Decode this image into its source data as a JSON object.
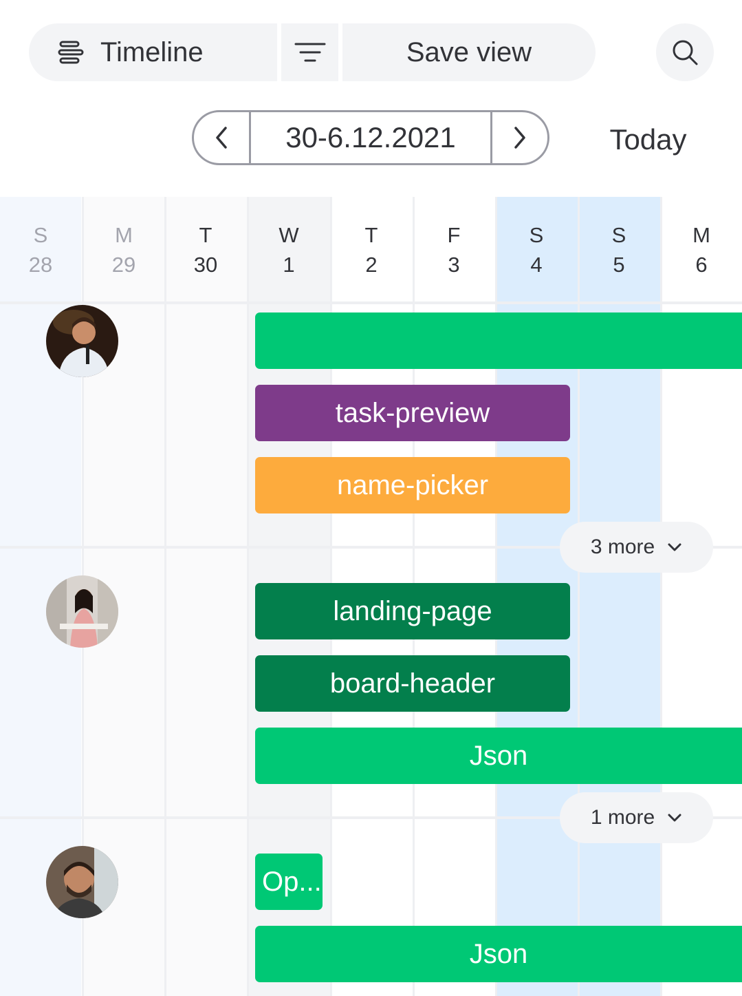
{
  "toolbar": {
    "view_label": "Timeline",
    "save_view_label": "Save view"
  },
  "date_nav": {
    "range": "30-6.12.2021",
    "today_label": "Today"
  },
  "days": [
    {
      "letter": "S",
      "num": "28"
    },
    {
      "letter": "M",
      "num": "29"
    },
    {
      "letter": "T",
      "num": "30"
    },
    {
      "letter": "W",
      "num": "1"
    },
    {
      "letter": "T",
      "num": "2"
    },
    {
      "letter": "F",
      "num": "3"
    },
    {
      "letter": "S",
      "num": "4"
    },
    {
      "letter": "S",
      "num": "5"
    },
    {
      "letter": "M",
      "num": "6"
    }
  ],
  "rows": [
    {
      "bars": [
        {
          "label": "",
          "color": "#00c875"
        },
        {
          "label": "task-preview",
          "color": "#7e3b8a"
        },
        {
          "label": "name-picker",
          "color": "#fdab3d"
        }
      ],
      "more_label": "3 more"
    },
    {
      "bars": [
        {
          "label": "landing-page",
          "color": "#037f4c"
        },
        {
          "label": "board-header",
          "color": "#037f4c"
        },
        {
          "label": "Json",
          "color": "#00c875"
        }
      ],
      "more_label": "1 more"
    },
    {
      "bars": [
        {
          "label": "Op...",
          "color": "#00c875"
        },
        {
          "label": "Json",
          "color": "#00c875"
        }
      ]
    }
  ],
  "colors": {
    "weekend_past": "#f3f7fd",
    "past": "#fafafb",
    "today_col": "#f3f4f6",
    "weekend": "#dcedfd",
    "accent_green": "#00c875",
    "dark_green": "#037f4c",
    "purple": "#7e3b8a",
    "orange": "#fdab3d"
  }
}
